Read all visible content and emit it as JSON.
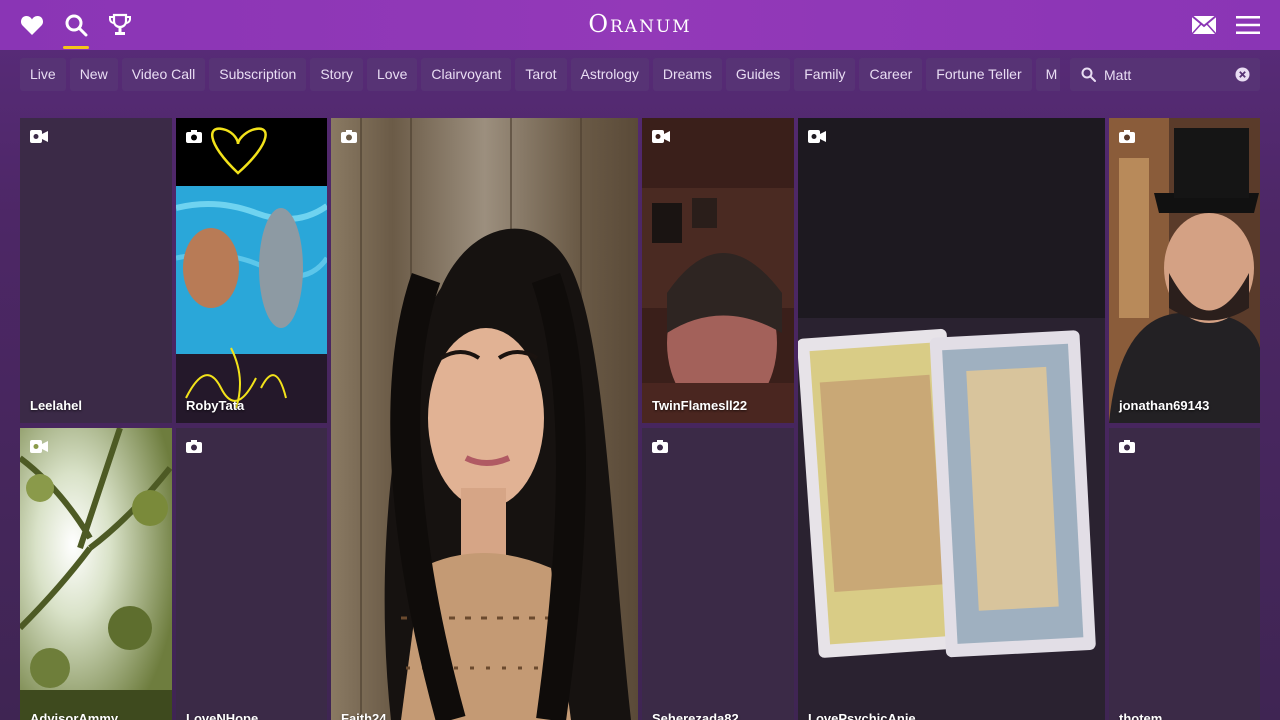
{
  "header": {
    "logo": "Oranum",
    "icons": [
      "heart-icon",
      "search-icon",
      "trophy-icon",
      "mail-icon",
      "menu-icon"
    ],
    "accent_color": "#f5c518"
  },
  "categories": [
    "Live",
    "New",
    "Video Call",
    "Subscription",
    "Story",
    "Love",
    "Clairvoyant",
    "Tarot",
    "Astrology",
    "Dreams",
    "Guides",
    "Family",
    "Career",
    "Fortune Teller",
    "M"
  ],
  "search": {
    "value": "Matt",
    "placeholder": ""
  },
  "tiles": [
    {
      "name": "Leelahel",
      "badge": "video-icon"
    },
    {
      "name": "RobyTata",
      "badge": "camera-icon"
    },
    {
      "name": "Faith24",
      "badge": "camera-icon"
    },
    {
      "name": "TwinFlamesll22",
      "badge": "video-icon"
    },
    {
      "name": "LovePsychicAnie",
      "badge": "video-icon"
    },
    {
      "name": "jonathan69143",
      "badge": "camera-icon"
    },
    {
      "name": "AdvisorAmmy",
      "badge": "video-icon"
    },
    {
      "name": "LoveNHope",
      "badge": "camera-icon"
    },
    {
      "name": "Seherezada82",
      "badge": "camera-icon"
    },
    {
      "name": "thotem",
      "badge": "camera-icon"
    }
  ]
}
